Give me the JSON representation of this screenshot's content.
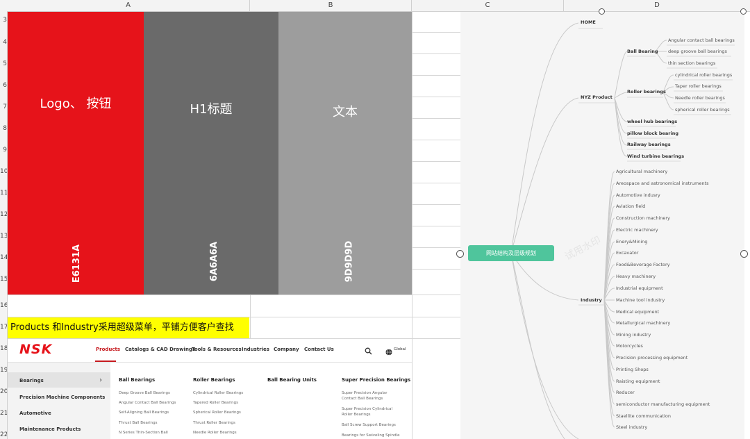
{
  "columns": [
    "A",
    "B",
    "C",
    "D"
  ],
  "rows": [
    "3",
    "4",
    "5",
    "6",
    "7",
    "8",
    "9",
    "10",
    "11",
    "12",
    "13",
    "14",
    "15",
    "16",
    "17",
    "18",
    "19",
    "20",
    "21",
    "22"
  ],
  "swatches": [
    {
      "title": "Logo、 按钮",
      "code": "E6131A",
      "color": "#E6131A"
    },
    {
      "title": "H1标题",
      "code": "6A6A6A",
      "color": "#6A6A6A"
    },
    {
      "title": "文本",
      "code": "9D9D9D",
      "color": "#9D9D9D"
    }
  ],
  "note": "Products 和Industry采用超级菜单，平铺方便客户查找",
  "nsk": {
    "logo": "NSK",
    "nav": [
      "Products",
      "Catalogs & CAD Drawings",
      "Tools & Resources",
      "Industries",
      "Company",
      "Contact Us"
    ],
    "global": "Global",
    "sidebar": [
      "Bearings",
      "Precision Machine Components",
      "Automotive",
      "Maintenance Products"
    ],
    "menu_heads": [
      "Ball Bearings",
      "Roller Bearings",
      "Ball Bearing Units",
      "Super Precision Bearings"
    ],
    "col1": [
      "Deep Groove Ball Bearings",
      "Angular Contact Ball Bearings",
      "Self-Aligning Ball Bearings",
      "Thrust Ball Bearings",
      "N Series Thin-Section Ball"
    ],
    "col2": [
      "Cylindrical Roller Bearings",
      "Tapered Roller Bearings",
      "Spherical Roller Bearings",
      "Thrust Roller Bearings",
      "Needle Roller Bearings"
    ],
    "col4": [
      "Super Precision Angular",
      "Contact Ball Bearings",
      "Super Precision Cylindrical",
      "Roller Bearings",
      "Ball Screw Support Bearings",
      "Bearings for Swiveling Spindle"
    ]
  },
  "mindmap": {
    "root": "网站结构及层级规划",
    "watermark": "试用水印",
    "home": "HOME",
    "nyz": "NYZ Product",
    "ball": "Ball Bearing",
    "ball_items": [
      "Angular contact ball bearings",
      "deep groove ball bearings",
      "thin section bearings"
    ],
    "roller": "Roller bearings",
    "roller_items": [
      "cylindrical roller bearings",
      "Taper roller bearings",
      "Needle roller bearings",
      "spherical roller bearings"
    ],
    "other_items": [
      "wheel hub bearings",
      "pillow block bearing",
      "Railway bearings",
      "Wind turbine bearings"
    ],
    "industry": "Industry",
    "industry_items": [
      "Agricultural machinery",
      "Areospace and astronomical instruments",
      "Automotive indusry",
      "Aviation field",
      "Construction machinery",
      "Electric machinery",
      "Enery&Mining",
      "Excavator",
      "Food&Beverage Factory",
      "Heavy machinery",
      "Industrial equipment",
      "Machine tool industry",
      "Medical equipment",
      "Metallurgical machinery",
      "Mining industry",
      "Motorcycles",
      "Precision processing equipment",
      "Printing Shops",
      "Raisting equipment",
      "Reducer",
      "semiconductor manufacturing equipment",
      "Staellite communication",
      "Steel industry"
    ]
  }
}
